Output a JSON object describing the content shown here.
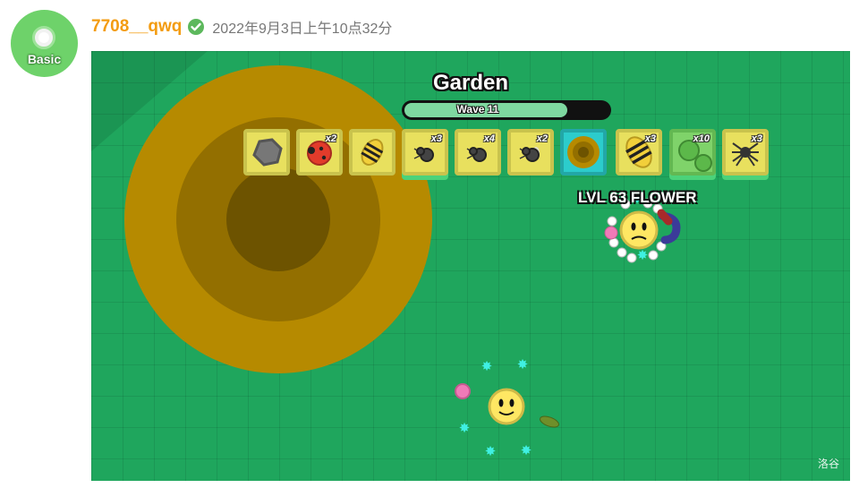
{
  "user": {
    "avatar_badge": "Basic",
    "username": "7708__qwq",
    "timestamp": "2022年9月3日上午10点32分"
  },
  "game": {
    "biome": "Garden",
    "wave_label": "Wave 11",
    "wave_progress": 0.8,
    "flower_label": "LVL 63 FLOWER",
    "watermark": "洛谷",
    "mobs": [
      {
        "icon": "rock-icon",
        "count": ""
      },
      {
        "icon": "ladybug-icon",
        "count": "x2"
      },
      {
        "icon": "bee-icon",
        "count": ""
      },
      {
        "icon": "ant-icon",
        "count": "x3"
      },
      {
        "icon": "ant-icon",
        "count": "x4"
      },
      {
        "icon": "soldier-ant-icon",
        "count": "x2"
      },
      {
        "icon": "ant-hole-icon",
        "count": ""
      },
      {
        "icon": "bee-icon",
        "count": "x3"
      },
      {
        "icon": "cactus-icon",
        "count": "x10"
      },
      {
        "icon": "spider-icon",
        "count": "x3"
      }
    ]
  }
}
